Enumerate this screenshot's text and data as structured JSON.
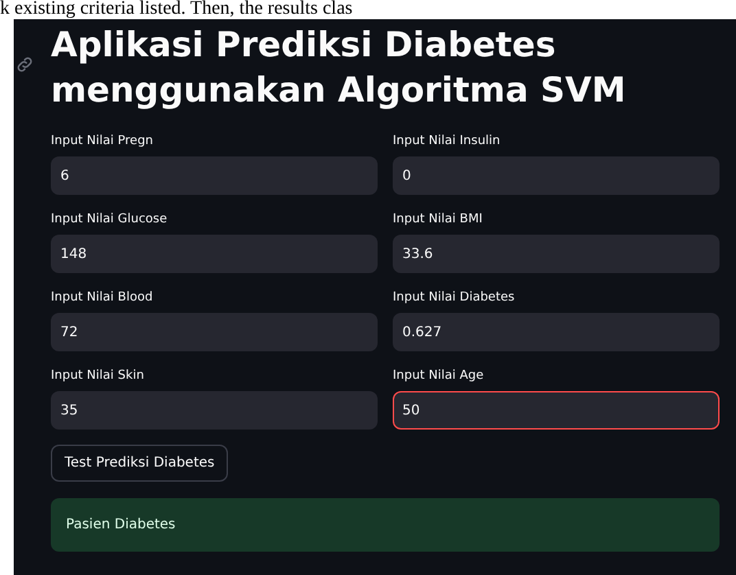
{
  "document_text": "k existing criteria listed. Then, the results clas",
  "app": {
    "title": "Aplikasi Prediksi Diabetes menggunakan Algoritma SVM",
    "fields": [
      {
        "label": "Input Nilai Pregn",
        "value": "6",
        "focused": false
      },
      {
        "label": "Input Nilai Insulin",
        "value": "0",
        "focused": false
      },
      {
        "label": "Input Nilai Glucose",
        "value": "148",
        "focused": false
      },
      {
        "label": "Input Nilai BMI",
        "value": "33.6",
        "focused": false
      },
      {
        "label": "Input Nilai Blood",
        "value": "72",
        "focused": false
      },
      {
        "label": "Input Nilai Diabetes",
        "value": "0.627",
        "focused": false
      },
      {
        "label": "Input Nilai Skin",
        "value": "35",
        "focused": false
      },
      {
        "label": "Input Nilai Age",
        "value": "50",
        "focused": true
      }
    ],
    "button": "Test Prediksi Diabetes",
    "result": "Pasien Diabetes"
  }
}
